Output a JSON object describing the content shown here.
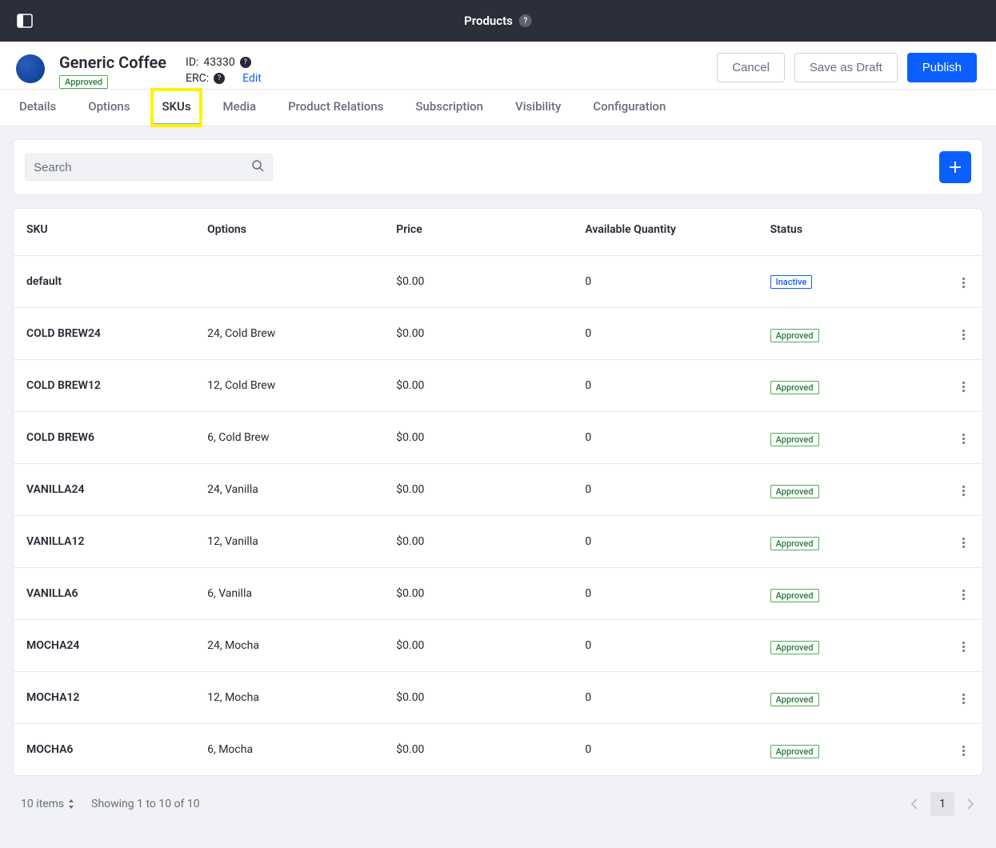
{
  "topbar": {
    "title": "Products"
  },
  "product": {
    "name": "Generic Coffee",
    "status": "Approved",
    "id_label": "ID:",
    "id_value": "43330",
    "erc_label": "ERC:",
    "edit": "Edit"
  },
  "actions": {
    "cancel": "Cancel",
    "save_draft": "Save as Draft",
    "publish": "Publish"
  },
  "tabs": {
    "details": "Details",
    "options": "Options",
    "skus": "SKUs",
    "media": "Media",
    "relations": "Product Relations",
    "subscription": "Subscription",
    "visibility": "Visibility",
    "configuration": "Configuration"
  },
  "search": {
    "placeholder": "Search"
  },
  "table": {
    "headers": {
      "sku": "SKU",
      "options": "Options",
      "price": "Price",
      "qty": "Available Quantity",
      "status": "Status"
    },
    "rows": [
      {
        "sku": "default",
        "options": "",
        "price": "$0.00",
        "qty": "0",
        "status": "Inactive",
        "status_type": "inactive"
      },
      {
        "sku": "COLD BREW24",
        "options": "24, Cold Brew",
        "price": "$0.00",
        "qty": "0",
        "status": "Approved",
        "status_type": "approved"
      },
      {
        "sku": "COLD BREW12",
        "options": "12, Cold Brew",
        "price": "$0.00",
        "qty": "0",
        "status": "Approved",
        "status_type": "approved"
      },
      {
        "sku": "COLD BREW6",
        "options": "6, Cold Brew",
        "price": "$0.00",
        "qty": "0",
        "status": "Approved",
        "status_type": "approved"
      },
      {
        "sku": "VANILLA24",
        "options": "24, Vanilla",
        "price": "$0.00",
        "qty": "0",
        "status": "Approved",
        "status_type": "approved"
      },
      {
        "sku": "VANILLA12",
        "options": "12, Vanilla",
        "price": "$0.00",
        "qty": "0",
        "status": "Approved",
        "status_type": "approved"
      },
      {
        "sku": "VANILLA6",
        "options": "6, Vanilla",
        "price": "$0.00",
        "qty": "0",
        "status": "Approved",
        "status_type": "approved"
      },
      {
        "sku": "MOCHA24",
        "options": "24, Mocha",
        "price": "$0.00",
        "qty": "0",
        "status": "Approved",
        "status_type": "approved"
      },
      {
        "sku": "MOCHA12",
        "options": "12, Mocha",
        "price": "$0.00",
        "qty": "0",
        "status": "Approved",
        "status_type": "approved"
      },
      {
        "sku": "MOCHA6",
        "options": "6, Mocha",
        "price": "$0.00",
        "qty": "0",
        "status": "Approved",
        "status_type": "approved"
      }
    ]
  },
  "footer": {
    "count": "10 items",
    "showing": "Showing 1 to 10 of 10",
    "page": "1"
  }
}
